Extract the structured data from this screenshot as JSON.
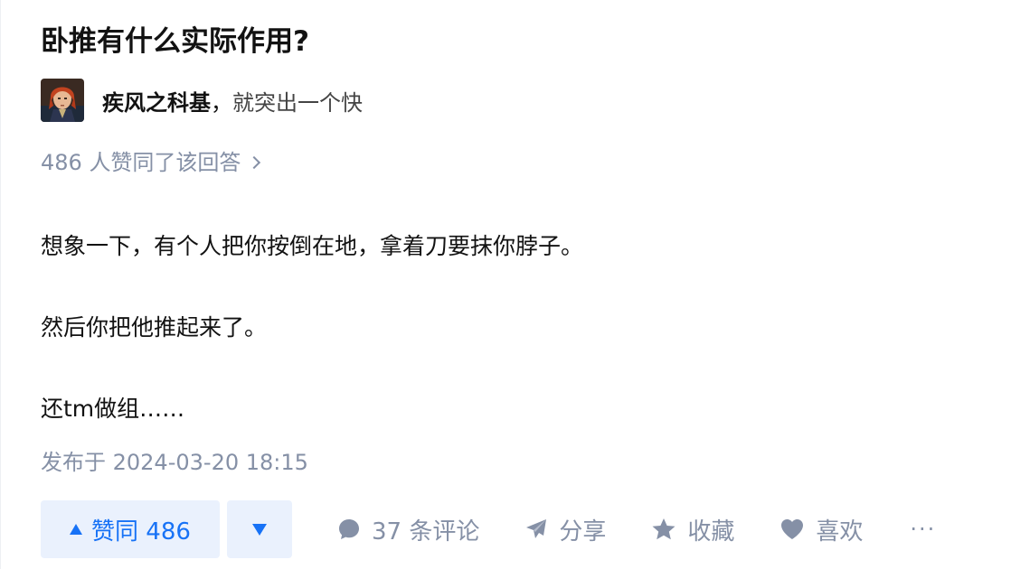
{
  "question": {
    "title": "卧推有什么实际作用?"
  },
  "author": {
    "name": "疾风之科基",
    "separator": "，",
    "bio": "就突出一个快"
  },
  "voters": {
    "text": "486 人赞同了该回答"
  },
  "answer": {
    "paragraphs": [
      "想象一下，有个人把你按倒在地，拿着刀要抹你脖子。",
      "然后你把他推起来了。",
      "还tm做组……"
    ],
    "published": "发布于 2024-03-20 18:15"
  },
  "actions": {
    "upvote_label": "赞同 486",
    "comments_label": "37 条评论",
    "share_label": "分享",
    "favorite_label": "收藏",
    "like_label": "喜欢",
    "more_label": "···"
  },
  "colors": {
    "accent": "#1772f6",
    "accent_bg": "#eaf1fd",
    "muted": "#8590a6",
    "text": "#121212"
  }
}
